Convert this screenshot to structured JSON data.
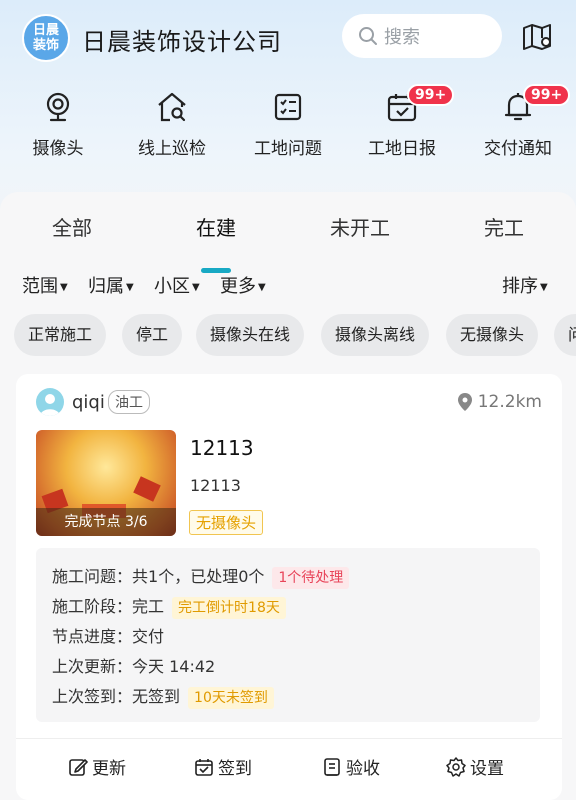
{
  "header": {
    "logo_line1": "日晨",
    "logo_line2": "装饰",
    "company": "日晨装饰设计公司",
    "search_placeholder": "搜索"
  },
  "quick_nav": [
    {
      "label": "摄像头",
      "icon": "camera-icon"
    },
    {
      "label": "线上巡检",
      "icon": "house-search-icon"
    },
    {
      "label": "工地问题",
      "icon": "checklist-icon"
    },
    {
      "label": "工地日报",
      "icon": "calendar-check-icon",
      "badge": "99+"
    },
    {
      "label": "交付通知",
      "icon": "bell-icon",
      "badge": "99+"
    }
  ],
  "tabs": [
    "全部",
    "在建",
    "未开工",
    "完工"
  ],
  "active_tab": "在建",
  "filters": [
    "范围",
    "归属",
    "小区",
    "更多"
  ],
  "sort": "排序",
  "chips": [
    "正常施工",
    "停工",
    "摄像头在线",
    "摄像头离线",
    "无摄像头",
    "问"
  ],
  "card": {
    "user": "qiqi",
    "role": "油工",
    "distance": "12.2km",
    "progress": "完成节点 3/6",
    "name": "12113",
    "address": "12113",
    "tag": "无摄像头",
    "rows": {
      "issues_label": "施工问题：",
      "issues_value": "共1个，已处理0个",
      "issues_pill": "1个待处理",
      "stage_label": "施工阶段：",
      "stage_value": "完工",
      "stage_pill": "完工倒计时18天",
      "node_label": "节点进度：",
      "node_value": "交付",
      "update_label": "上次更新：",
      "update_value": "今天 14:42",
      "checkin_label": "上次签到：",
      "checkin_value": "无签到",
      "checkin_pill": "10天未签到"
    },
    "actions": [
      "更新",
      "签到",
      "验收",
      "设置"
    ]
  },
  "colors": {
    "accent": "#18a9c4",
    "badge": "#f0334b",
    "warning": "#e09a00",
    "danger": "#e8455a"
  }
}
